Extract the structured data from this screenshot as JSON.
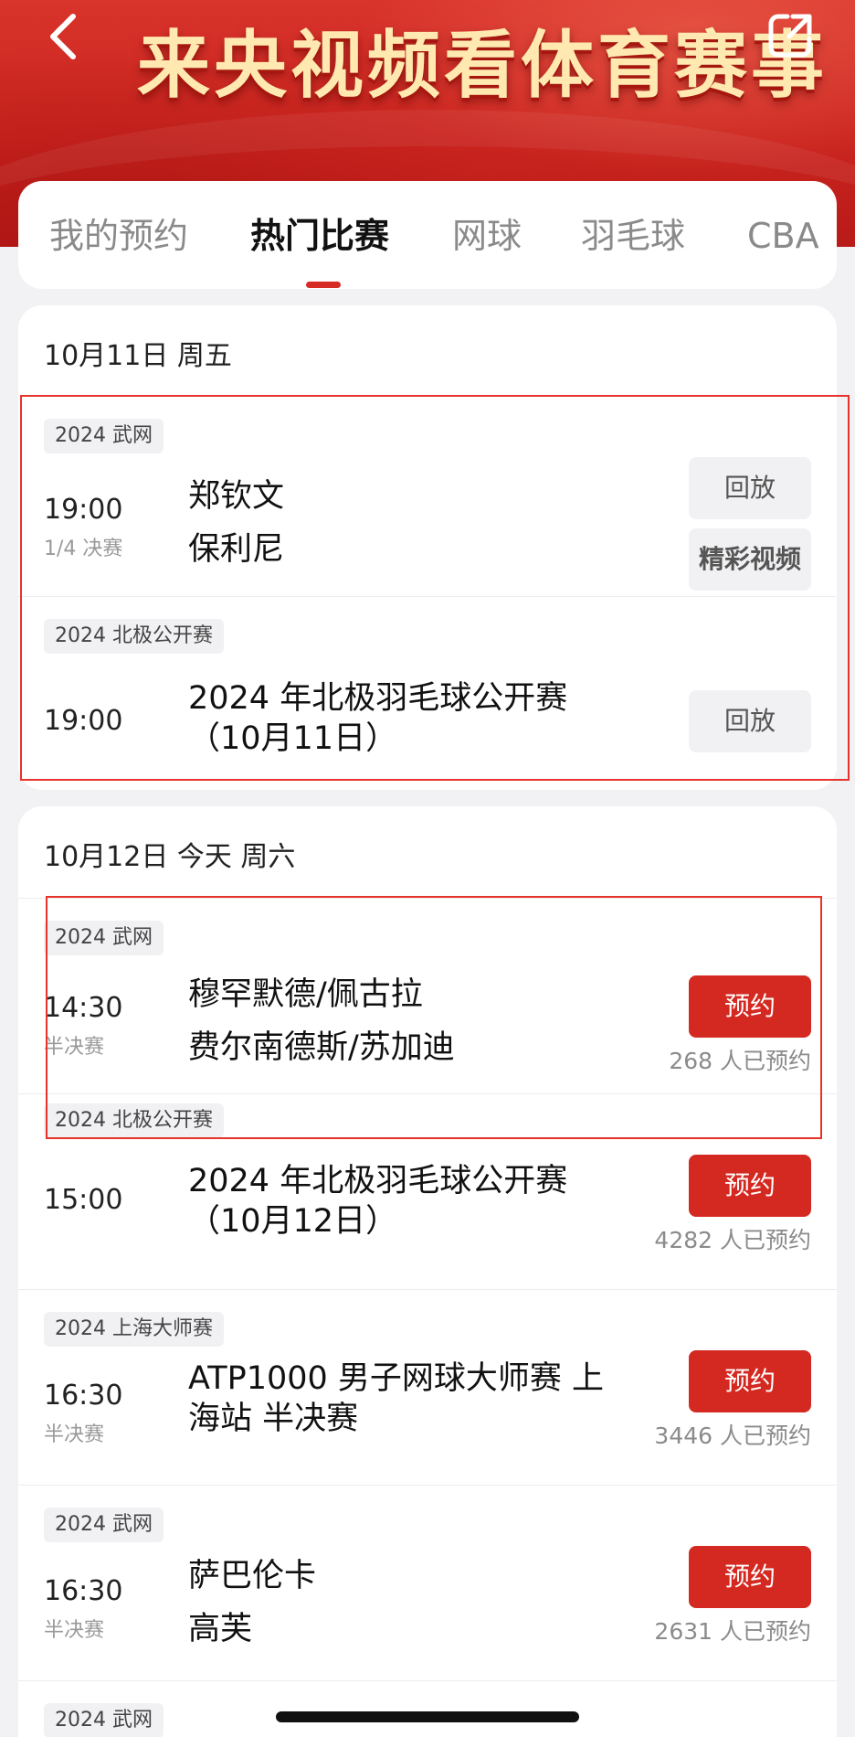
{
  "header": {
    "title": "来央视频看体育赛事",
    "back_icon": "chevron-left-icon",
    "share_icon": "share-icon"
  },
  "tabs": [
    {
      "label": "我的预约",
      "active": false
    },
    {
      "label": "热门比赛",
      "active": true
    },
    {
      "label": "网球",
      "active": false
    },
    {
      "label": "羽毛球",
      "active": false
    },
    {
      "label": "CBA",
      "active": false
    }
  ],
  "days": [
    {
      "date": "10月11日 周五",
      "matches": [
        {
          "tag": "2024 武网",
          "time": "19:00",
          "stage": "1/4 决赛",
          "lines": [
            "郑钦文",
            "保利尼"
          ],
          "buttons": [
            "回放",
            "精彩视频"
          ]
        },
        {
          "tag": "2024 北极公开赛",
          "time": "19:00",
          "stage": "",
          "lines": [
            "2024 年北极羽毛球公开赛",
            "（10月11日）"
          ],
          "buttons": [
            "回放"
          ]
        }
      ]
    },
    {
      "date": "10月12日 今天 周六",
      "matches": [
        {
          "tag": "2024 武网",
          "time": "14:30",
          "stage": "半决赛",
          "lines": [
            "穆罕默德/佩古拉",
            "费尔南德斯/苏加迪"
          ],
          "buttons": [
            "预约"
          ],
          "count": "268 人已预约"
        },
        {
          "tag": "2024 北极公开赛",
          "time": "15:00",
          "stage": "",
          "lines": [
            "2024 年北极羽毛球公开赛",
            "（10月12日）"
          ],
          "buttons": [
            "预约"
          ],
          "count": "4282 人已预约"
        },
        {
          "tag": "2024 上海大师赛",
          "time": "16:30",
          "stage": "半决赛",
          "lines": [
            "ATP1000 男子网球大师赛 上",
            "海站 半决赛"
          ],
          "buttons": [
            "预约"
          ],
          "count": "3446 人已预约"
        },
        {
          "tag": "2024 武网",
          "time": "16:30",
          "stage": "半决赛",
          "lines": [
            "萨巴伦卡",
            "高芙"
          ],
          "buttons": [
            "预约"
          ],
          "count": "2631 人已预约"
        },
        {
          "tag": "2024 武网"
        }
      ]
    }
  ],
  "colors": {
    "brand_red": "#d42921",
    "banner_red": "#c9231e",
    "title_gold": "#ffe9b0",
    "annotation_red": "#e8332c"
  }
}
